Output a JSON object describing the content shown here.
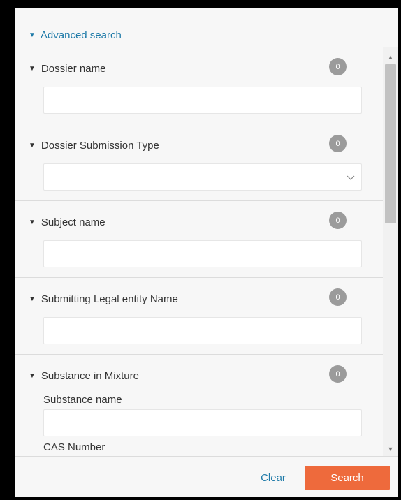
{
  "panel": {
    "advanced_search_label": "Advanced search"
  },
  "sections": [
    {
      "title": "Dossier name",
      "count": "0",
      "field_value": ""
    },
    {
      "title": "Dossier Submission Type",
      "count": "0",
      "selected_value": ""
    },
    {
      "title": "Subject name",
      "count": "0",
      "field_value": ""
    },
    {
      "title": "Submitting Legal entity Name",
      "count": "0",
      "field_value": ""
    },
    {
      "title": "Substance in Mixture",
      "count": "0",
      "substance_name_label": "Substance name",
      "substance_name_value": "",
      "cas_number_label": "CAS Number"
    }
  ],
  "footer": {
    "clear_label": "Clear",
    "search_label": "Search"
  },
  "colors": {
    "accent_link": "#1e7aa8",
    "search_button": "#ee6a3c",
    "badge": "#9b9b9b"
  },
  "icons": {
    "section_toggle": "triangle-down-icon",
    "dropdown": "chevron-down-icon",
    "scroll_up": "scroll-up-arrow-icon",
    "scroll_down": "scroll-down-arrow-icon"
  }
}
